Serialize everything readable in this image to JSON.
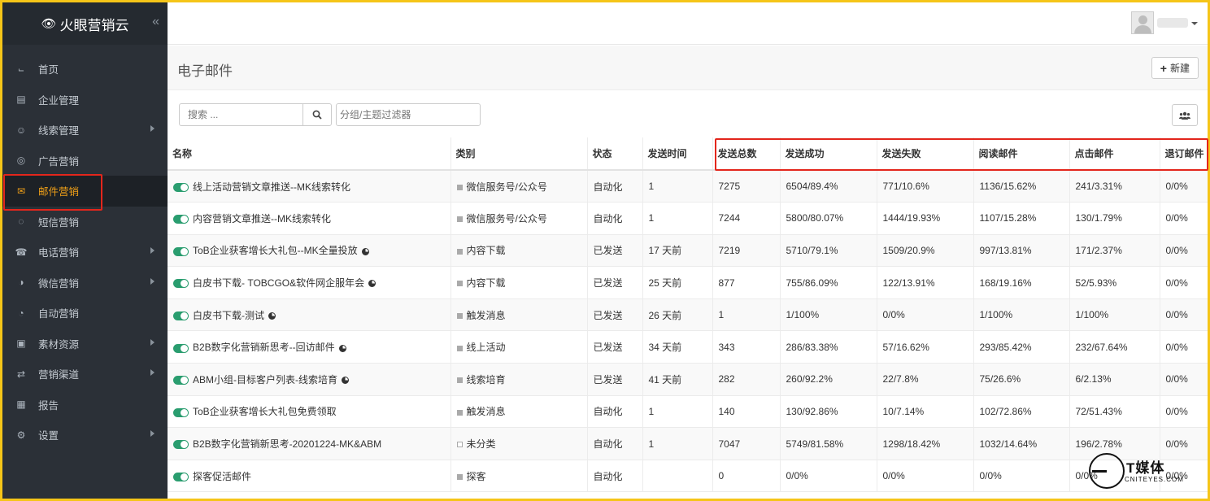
{
  "brand": {
    "name": "火眼营销云"
  },
  "nav": [
    {
      "label": "首页",
      "icon": "chart-line-icon",
      "arrow": false,
      "active": false
    },
    {
      "label": "企业管理",
      "icon": "building-icon",
      "arrow": false,
      "active": false
    },
    {
      "label": "线索管理",
      "icon": "user-icon",
      "arrow": true,
      "active": false
    },
    {
      "label": "广告营销",
      "icon": "ad-icon",
      "arrow": false,
      "active": false
    },
    {
      "label": "邮件营销",
      "icon": "envelope-icon",
      "arrow": false,
      "active": true
    },
    {
      "label": "短信营销",
      "icon": "chat-bubble-icon",
      "arrow": false,
      "active": false
    },
    {
      "label": "电话营销",
      "icon": "phone-icon",
      "arrow": true,
      "active": false
    },
    {
      "label": "微信营销",
      "icon": "wechat-icon",
      "arrow": true,
      "active": false
    },
    {
      "label": "自动营销",
      "icon": "gauge-icon",
      "arrow": false,
      "active": false
    },
    {
      "label": "素材资源",
      "icon": "image-icon",
      "arrow": true,
      "active": false
    },
    {
      "label": "营销渠道",
      "icon": "exchange-icon",
      "arrow": true,
      "active": false
    },
    {
      "label": "报告",
      "icon": "report-icon",
      "arrow": false,
      "active": false
    },
    {
      "label": "设置",
      "icon": "gear-icon",
      "arrow": true,
      "active": false
    }
  ],
  "page": {
    "title": "电子邮件",
    "new_label": "新建"
  },
  "filters": {
    "search_placeholder": "搜索 ...",
    "group_placeholder": "分组/主题过滤器"
  },
  "table": {
    "headers": [
      "名称",
      "类别",
      "状态",
      "发送时间",
      "发送总数",
      "发送成功",
      "发送失败",
      "阅读邮件",
      "点击邮件",
      "退订邮件"
    ],
    "rows": [
      {
        "name": "线上活动营销文章推送--MK线索转化",
        "pie": false,
        "category": "微信服务号/公众号",
        "cat_empty": false,
        "status": "自动化",
        "time": "1",
        "total": "7275",
        "success": "6504/89.4%",
        "fail": "771/10.6%",
        "read": "1136/15.62%",
        "click": "241/3.31%",
        "unsub": "0/0%"
      },
      {
        "name": "内容营销文章推送--MK线索转化",
        "pie": false,
        "category": "微信服务号/公众号",
        "cat_empty": false,
        "status": "自动化",
        "time": "1",
        "total": "7244",
        "success": "5800/80.07%",
        "fail": "1444/19.93%",
        "read": "1107/15.28%",
        "click": "130/1.79%",
        "unsub": "0/0%"
      },
      {
        "name": "ToB企业获客增长大礼包--MK全量投放",
        "pie": true,
        "category": "内容下载",
        "cat_empty": false,
        "status": "已发送",
        "time": "17 天前",
        "total": "7219",
        "success": "5710/79.1%",
        "fail": "1509/20.9%",
        "read": "997/13.81%",
        "click": "171/2.37%",
        "unsub": "0/0%"
      },
      {
        "name": "白皮书下载- TOBCGO&软件网企服年会",
        "pie": true,
        "category": "内容下载",
        "cat_empty": false,
        "status": "已发送",
        "time": "25 天前",
        "total": "877",
        "success": "755/86.09%",
        "fail": "122/13.91%",
        "read": "168/19.16%",
        "click": "52/5.93%",
        "unsub": "0/0%"
      },
      {
        "name": "白皮书下载-测试",
        "pie": true,
        "category": "触发消息",
        "cat_empty": false,
        "status": "已发送",
        "time": "26 天前",
        "total": "1",
        "success": "1/100%",
        "fail": "0/0%",
        "read": "1/100%",
        "click": "1/100%",
        "unsub": "0/0%"
      },
      {
        "name": "B2B数字化营销新思考--回访邮件",
        "pie": true,
        "category": "线上活动",
        "cat_empty": false,
        "status": "已发送",
        "time": "34 天前",
        "total": "343",
        "success": "286/83.38%",
        "fail": "57/16.62%",
        "read": "293/85.42%",
        "click": "232/67.64%",
        "unsub": "0/0%"
      },
      {
        "name": "ABM小组-目标客户列表-线索培育",
        "pie": true,
        "category": "线索培育",
        "cat_empty": false,
        "status": "已发送",
        "time": "41 天前",
        "total": "282",
        "success": "260/92.2%",
        "fail": "22/7.8%",
        "read": "75/26.6%",
        "click": "6/2.13%",
        "unsub": "0/0%"
      },
      {
        "name": "ToB企业获客增长大礼包免费领取",
        "pie": false,
        "category": "触发消息",
        "cat_empty": false,
        "status": "自动化",
        "time": "1",
        "total": "140",
        "success": "130/92.86%",
        "fail": "10/7.14%",
        "read": "102/72.86%",
        "click": "72/51.43%",
        "unsub": "0/0%"
      },
      {
        "name": "B2B数字化营销新思考-20201224-MK&ABM",
        "pie": false,
        "category": "未分类",
        "cat_empty": true,
        "status": "自动化",
        "time": "1",
        "total": "7047",
        "success": "5749/81.58%",
        "fail": "1298/18.42%",
        "read": "1032/14.64%",
        "click": "196/2.78%",
        "unsub": "0/0%"
      },
      {
        "name": "探客促活邮件",
        "pie": false,
        "category": "探客",
        "cat_empty": false,
        "status": "自动化",
        "time": "",
        "total": "0",
        "success": "0/0%",
        "fail": "0/0%",
        "read": "0/0%",
        "click": "0/0%",
        "unsub": "0/0%"
      }
    ]
  },
  "watermark": {
    "title": "T媒体",
    "subtitle": "CNITEYES.COM"
  }
}
